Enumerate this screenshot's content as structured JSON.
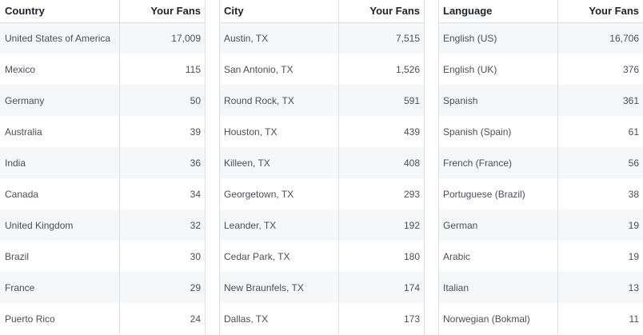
{
  "country_table": {
    "header": {
      "label": "Country",
      "value": "Your Fans"
    },
    "rows": [
      {
        "label": "United States of America",
        "value": "17,009"
      },
      {
        "label": "Mexico",
        "value": "115"
      },
      {
        "label": "Germany",
        "value": "50"
      },
      {
        "label": "Australia",
        "value": "39"
      },
      {
        "label": "India",
        "value": "36"
      },
      {
        "label": "Canada",
        "value": "34"
      },
      {
        "label": "United Kingdom",
        "value": "32"
      },
      {
        "label": "Brazil",
        "value": "30"
      },
      {
        "label": "France",
        "value": "29"
      },
      {
        "label": "Puerto Rico",
        "value": "24"
      }
    ]
  },
  "city_table": {
    "header": {
      "label": "City",
      "value": "Your Fans"
    },
    "rows": [
      {
        "label": "Austin, TX",
        "value": "7,515"
      },
      {
        "label": "San Antonio, TX",
        "value": "1,526"
      },
      {
        "label": "Round Rock, TX",
        "value": "591"
      },
      {
        "label": "Houston, TX",
        "value": "439"
      },
      {
        "label": "Killeen, TX",
        "value": "408"
      },
      {
        "label": "Georgetown, TX",
        "value": "293"
      },
      {
        "label": "Leander, TX",
        "value": "192"
      },
      {
        "label": "Cedar Park, TX",
        "value": "180"
      },
      {
        "label": "New Braunfels, TX",
        "value": "174"
      },
      {
        "label": "Dallas, TX",
        "value": "173"
      }
    ]
  },
  "language_table": {
    "header": {
      "label": "Language",
      "value": "Your Fans"
    },
    "rows": [
      {
        "label": "English (US)",
        "value": "16,706"
      },
      {
        "label": "English (UK)",
        "value": "376"
      },
      {
        "label": "Spanish",
        "value": "361"
      },
      {
        "label": "Spanish (Spain)",
        "value": "61"
      },
      {
        "label": "French (France)",
        "value": "56"
      },
      {
        "label": "Portuguese (Brazil)",
        "value": "38"
      },
      {
        "label": "German",
        "value": "19"
      },
      {
        "label": "Arabic",
        "value": "19"
      },
      {
        "label": "Italian",
        "value": "13"
      },
      {
        "label": "Norwegian (Bokmal)",
        "value": "11"
      }
    ]
  }
}
